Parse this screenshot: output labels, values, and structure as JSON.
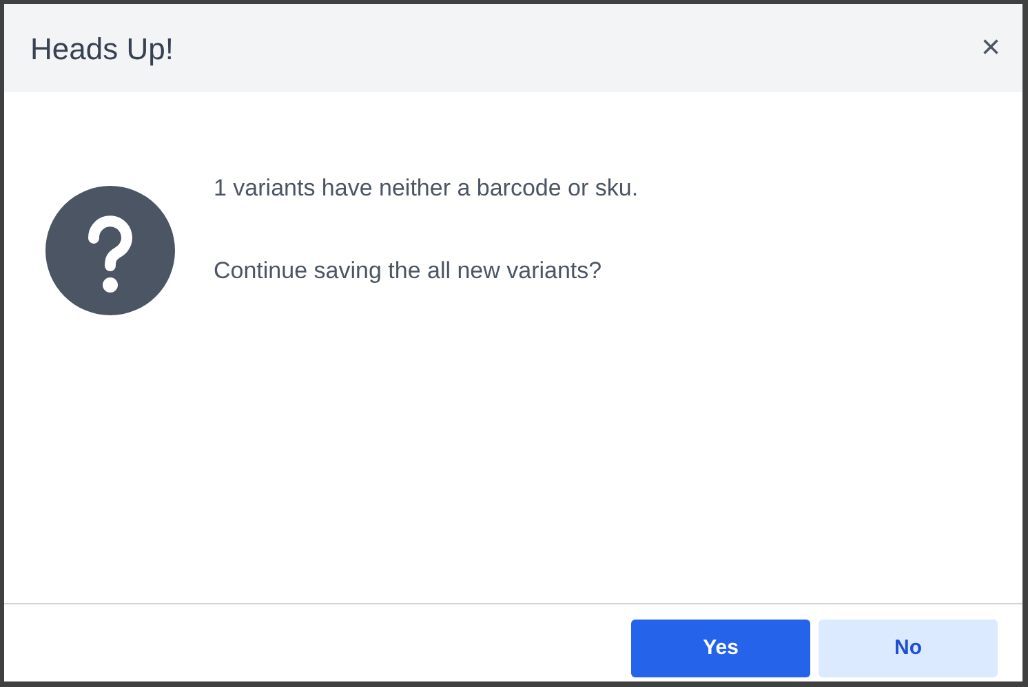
{
  "dialog": {
    "title": "Heads Up!",
    "close": "×"
  },
  "message": {
    "lines": [
      "1 variants have neither a barcode or sku.",
      "Continue saving the all new variants?"
    ]
  },
  "buttons": [
    {
      "label": "Yes",
      "kind": "primary"
    },
    {
      "label": "No",
      "kind": "secondary"
    }
  ]
}
